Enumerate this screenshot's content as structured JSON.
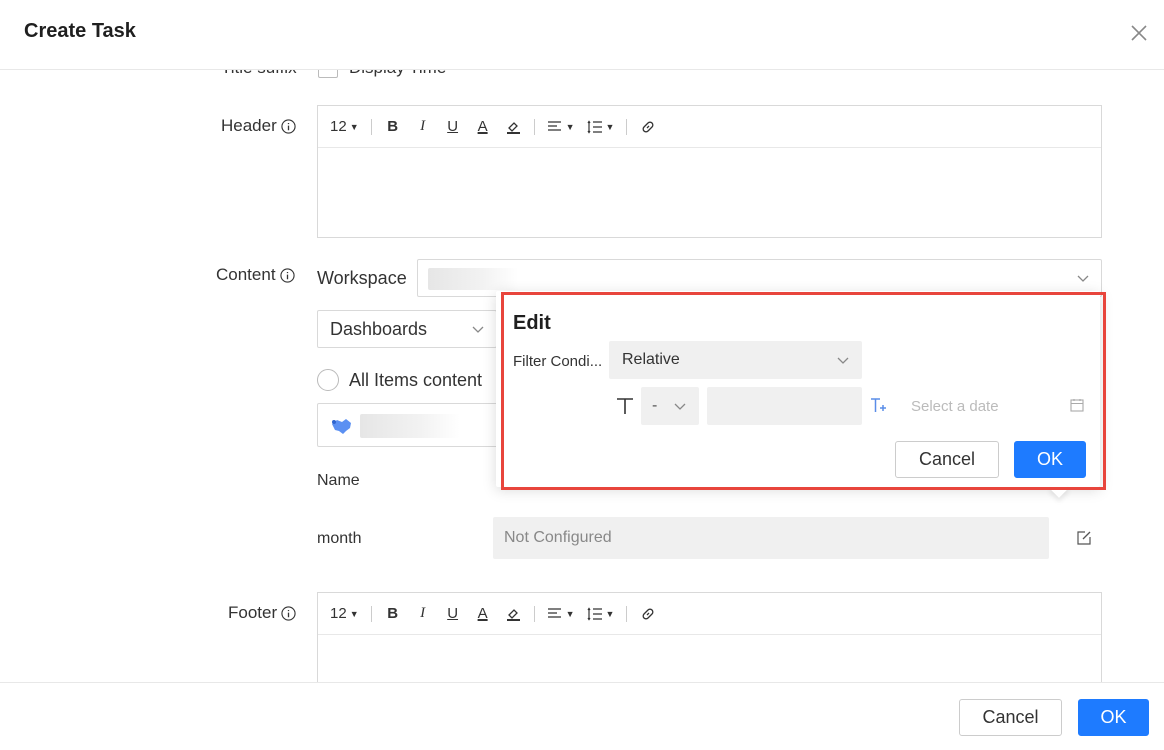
{
  "dialog": {
    "title": "Create Task"
  },
  "form": {
    "title_suffix_label": "Title suffix",
    "display_time_label": "Display Time",
    "header_label": "Header",
    "content_label": "Content",
    "footer_label": "Footer",
    "toolbar": {
      "font_size": "12"
    },
    "workspace_label": "Workspace",
    "type_select": "Dashboards",
    "all_items_label": "All Items content",
    "name_column": "Name",
    "param_name": "month",
    "param_value": "Not Configured"
  },
  "edit_popover": {
    "title": "Edit",
    "filter_label": "Filter Condi...",
    "filter_value": "Relative",
    "operator_value": "-",
    "date_placeholder": "Select a date",
    "cancel_label": "Cancel",
    "ok_label": "OK",
    "highlight_color": "#e8453c"
  },
  "footer": {
    "cancel_label": "Cancel",
    "ok_label": "OK"
  },
  "colors": {
    "primary": "#1e7bff"
  }
}
